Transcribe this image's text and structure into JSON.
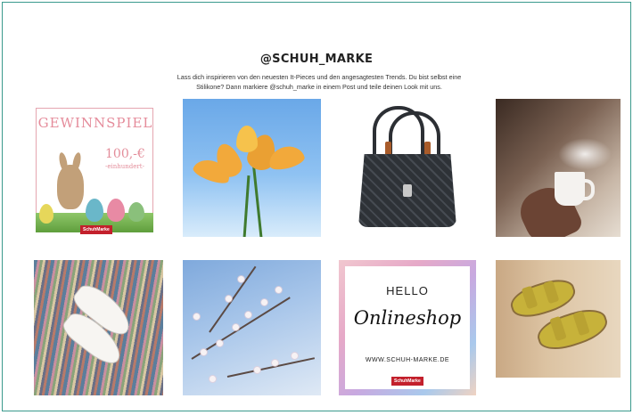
{
  "header": {
    "title": "@SCHUH_MARKE",
    "description": "Lass dich inspirieren von den neuesten It-Pieces und den angesagtesten Trends. Du bist selbst eine Stilikone? Dann markiere @schuh_marke in einem Post und teile deinen Look mit uns."
  },
  "posts": {
    "gewinnspiel": {
      "title": "GEWINNSPIEL",
      "amount": "100,-€",
      "amount_words": "-einhundert-",
      "badge": "SchuhMarke"
    },
    "hello": {
      "hello": "HELLO",
      "script": "Onlineshop",
      "url": "WWW.SCHUH-MARKE.DE",
      "badge": "SchuhMarke"
    }
  },
  "colors": {
    "accent_border": "#3a9a8d",
    "brand_red": "#c3202c"
  }
}
